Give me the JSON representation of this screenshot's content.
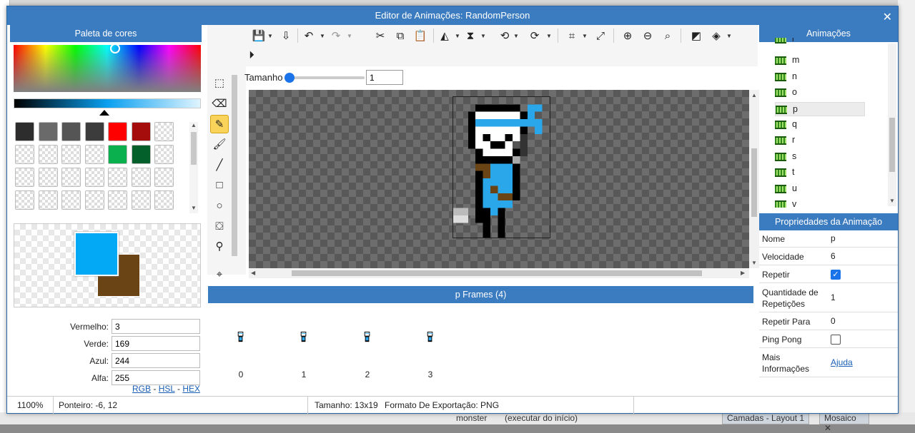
{
  "window": {
    "title": "Editor de Animações: RandomPerson"
  },
  "palette": {
    "title": "Paleta de cores",
    "swatch_colors": [
      "#2d2d2d",
      "#6a6a6a",
      "#555555",
      "#3c3c3c",
      "#ff0000",
      "#a50d0d",
      "",
      "",
      "",
      "",
      "",
      "#0ab04e",
      "#04602a",
      "",
      "",
      "",
      "",
      "",
      "",
      "",
      "",
      "",
      "",
      "",
      "",
      "",
      "",
      ""
    ],
    "primary_color": "#03a9f4",
    "secondary_color": "#6b4416"
  },
  "color_fields": {
    "red_label": "Vermelho:",
    "red_value": "3",
    "green_label": "Verde:",
    "green_value": "169",
    "blue_label": "Azul:",
    "blue_value": "244",
    "alpha_label": "Alfa:",
    "alpha_value": "255"
  },
  "format_links": {
    "rgb": "RGB",
    "hsl": "HSL",
    "hex": "HEX",
    "sep": "-"
  },
  "toolbar": {
    "size_label": "Tamanho",
    "size_value": "1"
  },
  "frames": {
    "title": "p Frames (4)",
    "items": [
      "0",
      "1",
      "2",
      "3"
    ]
  },
  "status": {
    "zoom": "1100%",
    "pointer": "Ponteiro: -6, 12",
    "size": "Tamanho: 13x19",
    "export": "Formato De Exportação: PNG"
  },
  "animations": {
    "title": "Animações",
    "items": [
      "l",
      "m",
      "n",
      "o",
      "p",
      "q",
      "r",
      "s",
      "t",
      "u",
      "v"
    ],
    "selected": "p"
  },
  "properties": {
    "title": "Propriedades da Animação",
    "name_label": "Nome",
    "name_value": "p",
    "speed_label": "Velocidade",
    "speed_value": "6",
    "loop_label": "Repetir",
    "loop_checked": true,
    "repeat_count_label": "Quantidade de Repetições",
    "repeat_count_value": "1",
    "repeat_to_label": "Repetir Para",
    "repeat_to_value": "0",
    "pingpong_label": "Ping Pong",
    "pingpong_checked": false,
    "more_label": "Mais Informações",
    "more_link": "Ajuda"
  },
  "background": {
    "bottom_item1": "monster",
    "bottom_item2": "(executar do início)",
    "tab1": "Camadas - Layout 1",
    "tab2": "Mosaico"
  }
}
